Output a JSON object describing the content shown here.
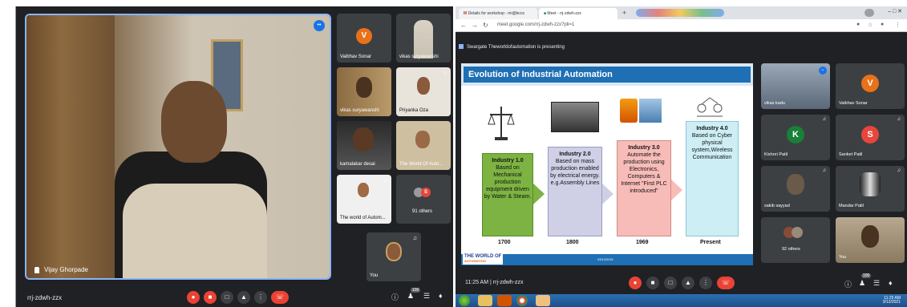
{
  "left": {
    "main_speaker": "Vijay Ghorpade",
    "meeting_code": "rrj-zdwh-zzx",
    "participants": [
      {
        "name": "Vaibhav Sonar",
        "initial": "V"
      },
      {
        "name": "vikas suryawanshi"
      },
      {
        "name": "Priyanka Oza"
      },
      {
        "name": "kamalakar desai"
      },
      {
        "name": "The World Of Auto..."
      },
      {
        "name": "The world of Autom..."
      },
      {
        "name": "91 others"
      },
      {
        "name": "You"
      }
    ],
    "participants_count": "100",
    "others_initial": "S"
  },
  "right": {
    "tabs": [
      {
        "label": "Details for workshop - mi@bcoc"
      },
      {
        "label": "Meet - rrj-zdwh-zzx"
      }
    ],
    "url": "meet.google.com/rrj-zdwh-zzx?pli=1",
    "presenting_text": "Swargate Theworldofautomation is presenting",
    "time": "11:25 AM",
    "meeting_code": "rrj-zdwh-zzx",
    "participants_count": "100",
    "tray_time": "11:25 AM",
    "tray_date": "3/12/2021",
    "slide": {
      "title": "Evolution of Industrial Automation",
      "stages": [
        {
          "heading": "Industry 1.0",
          "body": "Based on Mechanical production equipment driven by Water & Steam.",
          "year": "1700",
          "color": "#7cb342"
        },
        {
          "heading": "Industry 2.0",
          "body": "Based on mass production enabled by electrical energy. e.g.Assembly Lines",
          "year": "1800",
          "color": "#cfd0e6"
        },
        {
          "heading": "Industry 3.0",
          "body": "Automate the production using Electronics, Computers & Internet \"First PLC introduced\"",
          "year": "1969",
          "color": "#f8bcb8"
        },
        {
          "heading": "Industry 4.0",
          "body": "Based on Cyber physical system,Wireless Communication",
          "year": "Present",
          "color": "#cdeef5"
        }
      ],
      "logo_line1": "THE WORLD OF",
      "logo_line2": "AUTOMATION",
      "footer_date": "03/12/2021"
    },
    "participants": [
      {
        "name": "vikas kadu"
      },
      {
        "name": "Vaibhav Sonar",
        "initial": "V",
        "color": "#e8711a"
      },
      {
        "name": "Kishori Patil",
        "initial": "K",
        "color": "#188038"
      },
      {
        "name": "Sanket Patil",
        "initial": "S",
        "color": "#e8453c"
      },
      {
        "name": "sakib sayyad"
      },
      {
        "name": "Mandar Patil"
      },
      {
        "name": "92 others"
      },
      {
        "name": "You"
      }
    ]
  }
}
